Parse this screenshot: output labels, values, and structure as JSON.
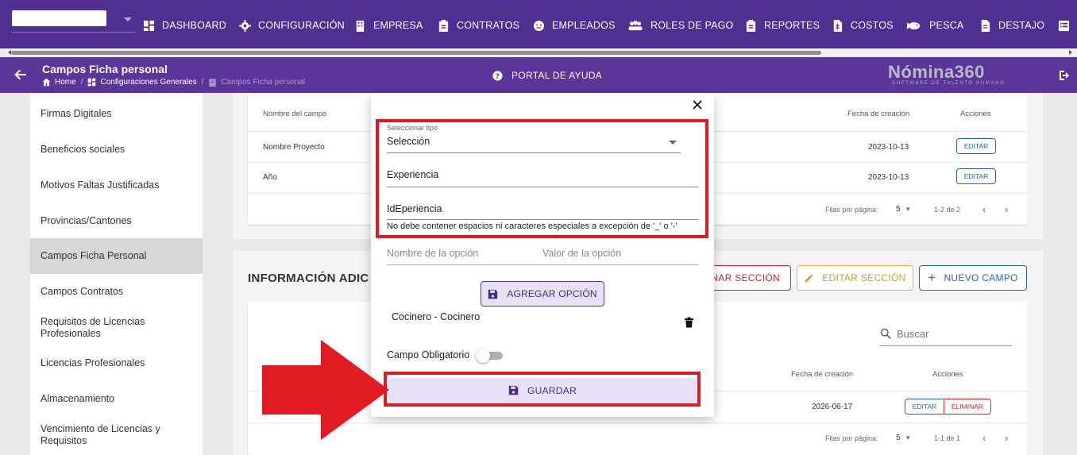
{
  "nav": {
    "items": [
      {
        "label": "DASHBOARD",
        "icon": "dashboard-icon"
      },
      {
        "label": "CONFIGURACIÓN",
        "icon": "gear-icon"
      },
      {
        "label": "EMPRESA",
        "icon": "building-icon"
      },
      {
        "label": "CONTRATOS",
        "icon": "clipboard-icon"
      },
      {
        "label": "EMPLEADOS",
        "icon": "face-icon"
      },
      {
        "label": "ROLES DE PAGO",
        "icon": "people-icon"
      },
      {
        "label": "REPORTES",
        "icon": "clipboard-icon"
      },
      {
        "label": "COSTOS",
        "icon": "dollar-file-icon"
      },
      {
        "label": "PESCA",
        "icon": "fish-icon"
      },
      {
        "label": "DESTAJO",
        "icon": "file-icon"
      }
    ]
  },
  "header": {
    "title": "Campos Ficha personal",
    "breadcrumb": [
      "Home",
      "Configuraciones Generales",
      "Campos Ficha personal"
    ],
    "help": "PORTAL DE AYUDA",
    "logo": "Nómina360",
    "logo_sub": "SOFTWARE DE TALENTO HUMANO"
  },
  "sidebar": {
    "items": [
      {
        "label": "Firmas Digitales"
      },
      {
        "label": "Beneficios sociales"
      },
      {
        "label": "Motivos Faltas Justificadas"
      },
      {
        "label": "Provincias/Cantones"
      },
      {
        "label": "Campos Ficha Personal"
      },
      {
        "label": "Campos Contratos"
      },
      {
        "label": "Requisitos de Licencias Profesionales"
      },
      {
        "label": "Licencias Profesionales"
      },
      {
        "label": "Almacenamiento"
      },
      {
        "label": "Vencimiento de Licencias y Requisitos"
      }
    ]
  },
  "table1": {
    "headers": {
      "name": "Nombre del campo",
      "date": "Fecha de creación",
      "actions": "Acciones"
    },
    "rows": [
      {
        "name": "Nombre Proyecto",
        "date": "2023-10-13",
        "edit": "EDITAR"
      },
      {
        "name": "Año",
        "date": "2023-10-13",
        "edit": "EDITAR"
      }
    ],
    "pager": {
      "label": "Filas por página:",
      "size": "5",
      "range": "1-2 de 2"
    }
  },
  "section2": {
    "title": "INFORMACIÓN ADIC",
    "delete_label": "MINAR SECCIÓN",
    "edit_label": "EDITAR SECCIÓN",
    "new_label": "NUEVO CAMPO",
    "search_placeholder": "Buscar",
    "headers": {
      "date": "Fecha de creación",
      "actions": "Acciones"
    },
    "rows": [
      {
        "date": "2026-06-17",
        "edit": "EDITAR",
        "delete": "ELIMINAR"
      }
    ],
    "pager": {
      "label": "Filas por página:",
      "size": "5",
      "range": "1-1 de 1"
    }
  },
  "modal": {
    "type_label": "Seleccionar tipo",
    "type_value": "Selección",
    "name_value": "Experiencia",
    "id_value": "IdEperiencia",
    "id_helper": "No debe contener espacios ni caracteres especiales a excepción de '_' o '-'",
    "option_name_placeholder": "Nombre de la opción",
    "option_value_placeholder": "Valor de la opción",
    "add_option_label": "AGREGAR OPCIÓN",
    "options": [
      "Cocinero - Cocinero"
    ],
    "required_label": "Campo Obligatorio",
    "required": false,
    "save_label": "GUARDAR"
  },
  "colors": {
    "nav_bg": "#4f2f8f",
    "subheader_bg": "#5a3699",
    "accent": "#4b2b85",
    "highlight": "#e01b24"
  }
}
